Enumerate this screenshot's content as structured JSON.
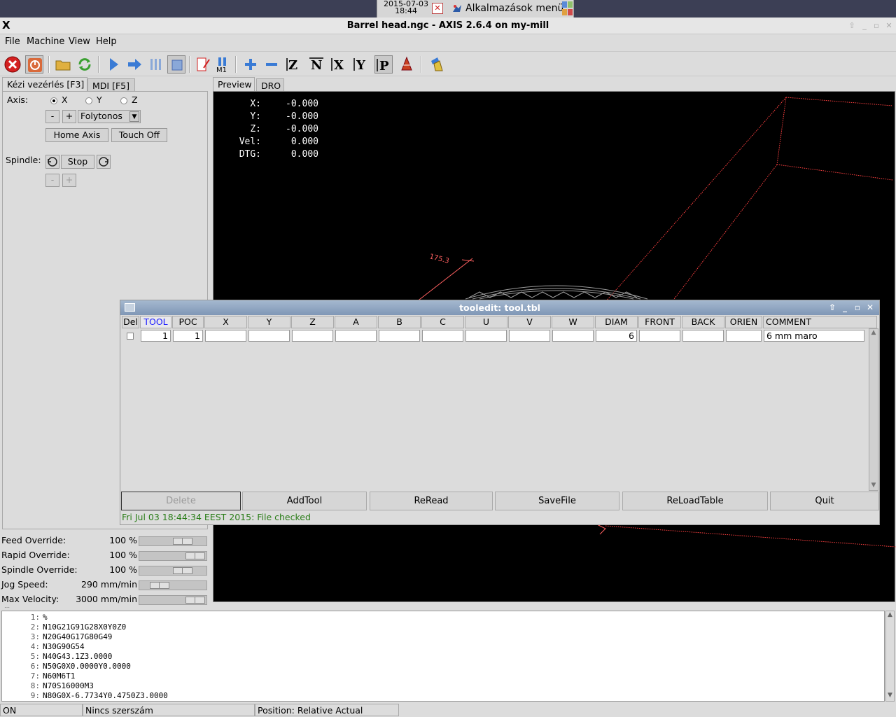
{
  "desktop": {
    "clock": "2015-07-03\n18:44",
    "apps_menu_label": "Alkalmazások menü"
  },
  "window": {
    "title": "Barrel head.ngc - AXIS 2.6.4 on my-mill"
  },
  "menubar": {
    "items": [
      "File",
      "Machine",
      "View",
      "Help"
    ]
  },
  "toolbar": {
    "icons": [
      "estop-icon",
      "machine-power-icon",
      "open-file-icon",
      "reload-icon",
      "run-icon",
      "step-icon",
      "pause-icon",
      "stop-icon",
      "block-delete-icon",
      "optional-stop-icon",
      "zoom-in-icon",
      "zoom-out-icon",
      "view-z-icon",
      "view-z2-icon",
      "view-x-icon",
      "view-y-icon",
      "view-p-icon",
      "toggle-plot-icon",
      "clear-plot-icon"
    ]
  },
  "left_panel": {
    "tabs": [
      "Kézi vezérlés [F3]",
      "MDI [F5]"
    ],
    "axis_label": "Axis:",
    "axes": [
      "X",
      "Y",
      "Z"
    ],
    "selected_axis": "X",
    "jog_minus": "-",
    "jog_plus": "+",
    "jog_mode": "Folytonos",
    "home_axis": "Home Axis",
    "touch_off": "Touch Off",
    "spindle_label": "Spindle:",
    "spindle_stop": "Stop",
    "spindle_minus": "-",
    "spindle_plus": "+"
  },
  "overrides": [
    {
      "label": "Feed Override:",
      "value": "100 %",
      "level": 0.72
    },
    {
      "label": "Rapid Override:",
      "value": "100 %",
      "level": 1.0
    },
    {
      "label": "Spindle Override:",
      "value": "100 %",
      "level": 0.72
    },
    {
      "label": "Jog Speed:",
      "value": "290 mm/min",
      "level": 0.22
    },
    {
      "label": "Max Velocity:",
      "value": "3000 mm/min",
      "level": 1.0
    }
  ],
  "preview": {
    "tabs": [
      "Preview",
      "DRO"
    ],
    "dro": [
      {
        "axis": "X:",
        "value": "-0.000"
      },
      {
        "axis": "Y:",
        "value": "-0.000"
      },
      {
        "axis": "Z:",
        "value": "-0.000"
      },
      {
        "axis": "Vel:",
        "value": "0.000"
      },
      {
        "axis": "DTG:",
        "value": "0.000"
      }
    ],
    "dimension_label": "175.3",
    "colors": {
      "background": "#000000",
      "toolpath": "#ff4040",
      "dimension": "#ff6060"
    }
  },
  "tooledit": {
    "title": "tooledit: tool.tbl",
    "columns": [
      "Del",
      "TOOL",
      "POC",
      "X",
      "Y",
      "Z",
      "A",
      "B",
      "C",
      "U",
      "V",
      "W",
      "DIAM",
      "FRONT",
      "BACK",
      "ORIEN",
      "COMMENT"
    ],
    "selected_column": "TOOL",
    "row": {
      "tool": "1",
      "poc": "1",
      "diam": "6",
      "comment": "6 mm maro"
    },
    "buttons": [
      "Delete",
      "AddTool",
      "ReRead",
      "SaveFile",
      "ReLoadTable",
      "Quit"
    ],
    "status": "Fri Jul 03 18:44:34 EEST 2015: File checked"
  },
  "gcode": [
    {
      "n": "1:",
      "text": "%"
    },
    {
      "n": "2:",
      "text": "N10G21G91G28X0Y0Z0"
    },
    {
      "n": "3:",
      "text": "N20G40G17G80G49"
    },
    {
      "n": "4:",
      "text": "N30G90G54"
    },
    {
      "n": "5:",
      "text": "N40G43.1Z3.0000"
    },
    {
      "n": "6:",
      "text": "N50G0X0.0000Y0.0000"
    },
    {
      "n": "7:",
      "text": "N60M6T1"
    },
    {
      "n": "8:",
      "text": "N70S16000M3"
    },
    {
      "n": "9:",
      "text": "N80G0X-6.7734Y0.4750Z3.0000"
    }
  ],
  "statusbar": {
    "state": "ON",
    "tool": "Nincs szerszám",
    "position": "Position: Relative Actual"
  }
}
